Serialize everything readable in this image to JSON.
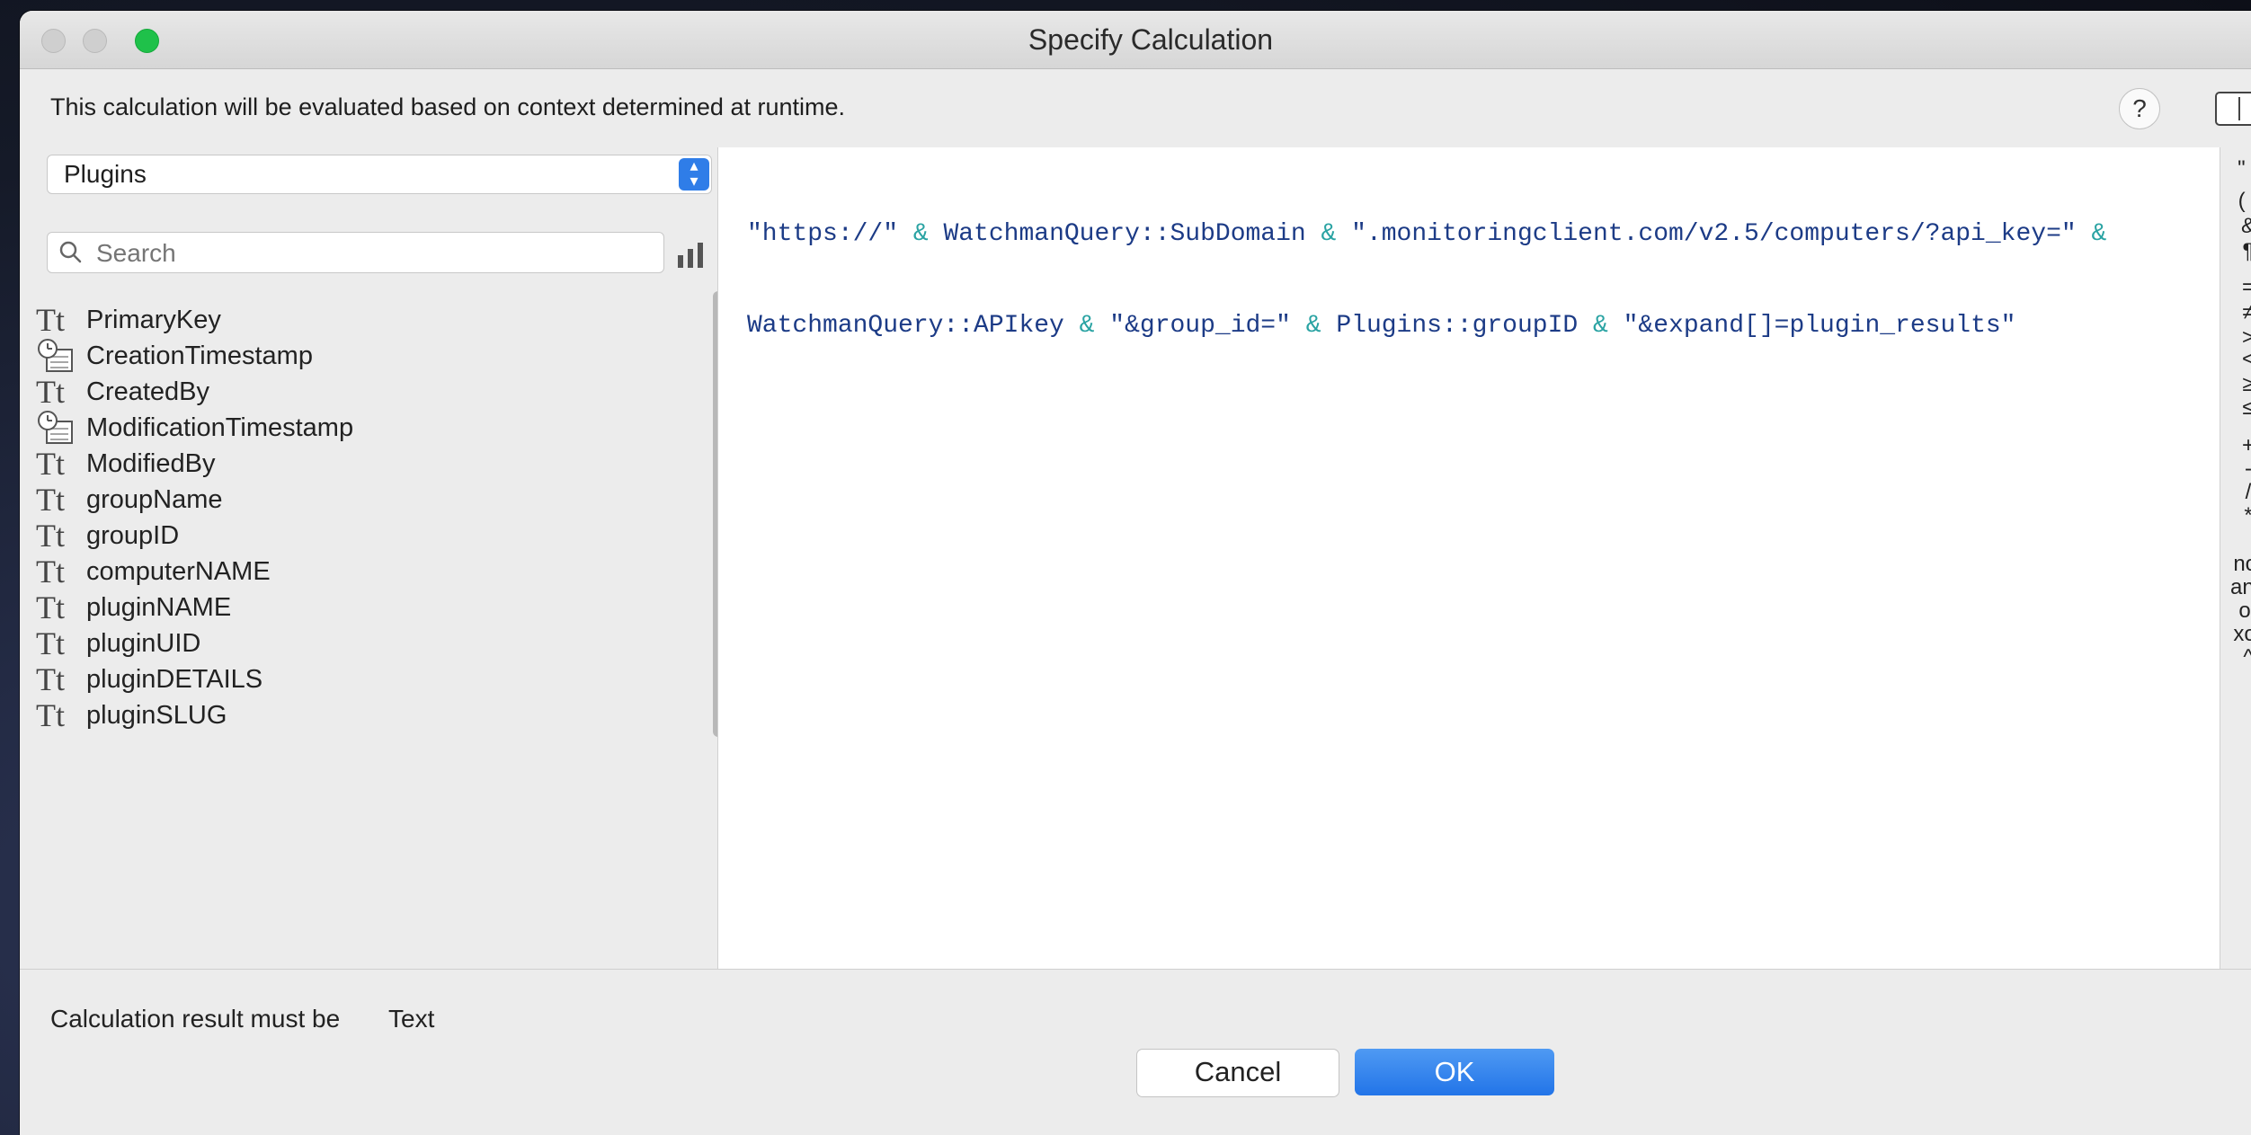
{
  "window": {
    "title": "Specify Calculation"
  },
  "context_note": "This calculation will be evaluated based on context determined at runtime.",
  "help_label": "?",
  "table_selector": {
    "value": "Plugins"
  },
  "search": {
    "placeholder": "Search",
    "value": ""
  },
  "fields": [
    {
      "name": "PrimaryKey",
      "type_icon": "text-type-icon"
    },
    {
      "name": "CreationTimestamp",
      "type_icon": "timestamp-type-icon"
    },
    {
      "name": "CreatedBy",
      "type_icon": "text-type-icon"
    },
    {
      "name": "ModificationTimestamp",
      "type_icon": "timestamp-type-icon"
    },
    {
      "name": "ModifiedBy",
      "type_icon": "text-type-icon"
    },
    {
      "name": "groupName",
      "type_icon": "text-type-icon"
    },
    {
      "name": "groupID",
      "type_icon": "text-type-icon"
    },
    {
      "name": "computerNAME",
      "type_icon": "text-type-icon"
    },
    {
      "name": "pluginNAME",
      "type_icon": "text-type-icon"
    },
    {
      "name": "pluginUID",
      "type_icon": "text-type-icon"
    },
    {
      "name": "pluginDETAILS",
      "type_icon": "text-type-icon"
    },
    {
      "name": "pluginSLUG",
      "type_icon": "text-type-icon"
    }
  ],
  "text_type_glyph": "Tt",
  "formula": {
    "line1": [
      {
        "t": "\"https://\"",
        "k": "str"
      },
      {
        "t": " & ",
        "k": "op"
      },
      {
        "t": "WatchmanQuery::SubDomain",
        "k": "field"
      },
      {
        "t": " & ",
        "k": "op"
      },
      {
        "t": "\".monitoringclient.com/v2.5/computers/?api_key=\"",
        "k": "str"
      },
      {
        "t": " &",
        "k": "op"
      }
    ],
    "line2": [
      {
        "t": "WatchmanQuery::APIkey",
        "k": "field"
      },
      {
        "t": " & ",
        "k": "op"
      },
      {
        "t": "\"&group_id=\"",
        "k": "str"
      },
      {
        "t": " & ",
        "k": "op"
      },
      {
        "t": "Plugins::groupID",
        "k": "field"
      },
      {
        "t": " & ",
        "k": "op"
      },
      {
        "t": "\"&expand[]=plugin_results\"",
        "k": "str"
      }
    ]
  },
  "operators": [
    "\" \"",
    "( )",
    "&",
    "¶",
    "=",
    "≠",
    ">",
    "<",
    "≥",
    "≤",
    "+",
    "-",
    "/",
    "*",
    "not",
    "and",
    "or",
    "xor",
    "^"
  ],
  "footer": {
    "result_label": "Calculation result must be",
    "result_type": "Text",
    "cancel_label": "Cancel",
    "ok_label": "OK"
  },
  "colors": {
    "accent": "#2f7de8",
    "ok_button": "#2f7de8",
    "window_chrome": "#ececec"
  }
}
